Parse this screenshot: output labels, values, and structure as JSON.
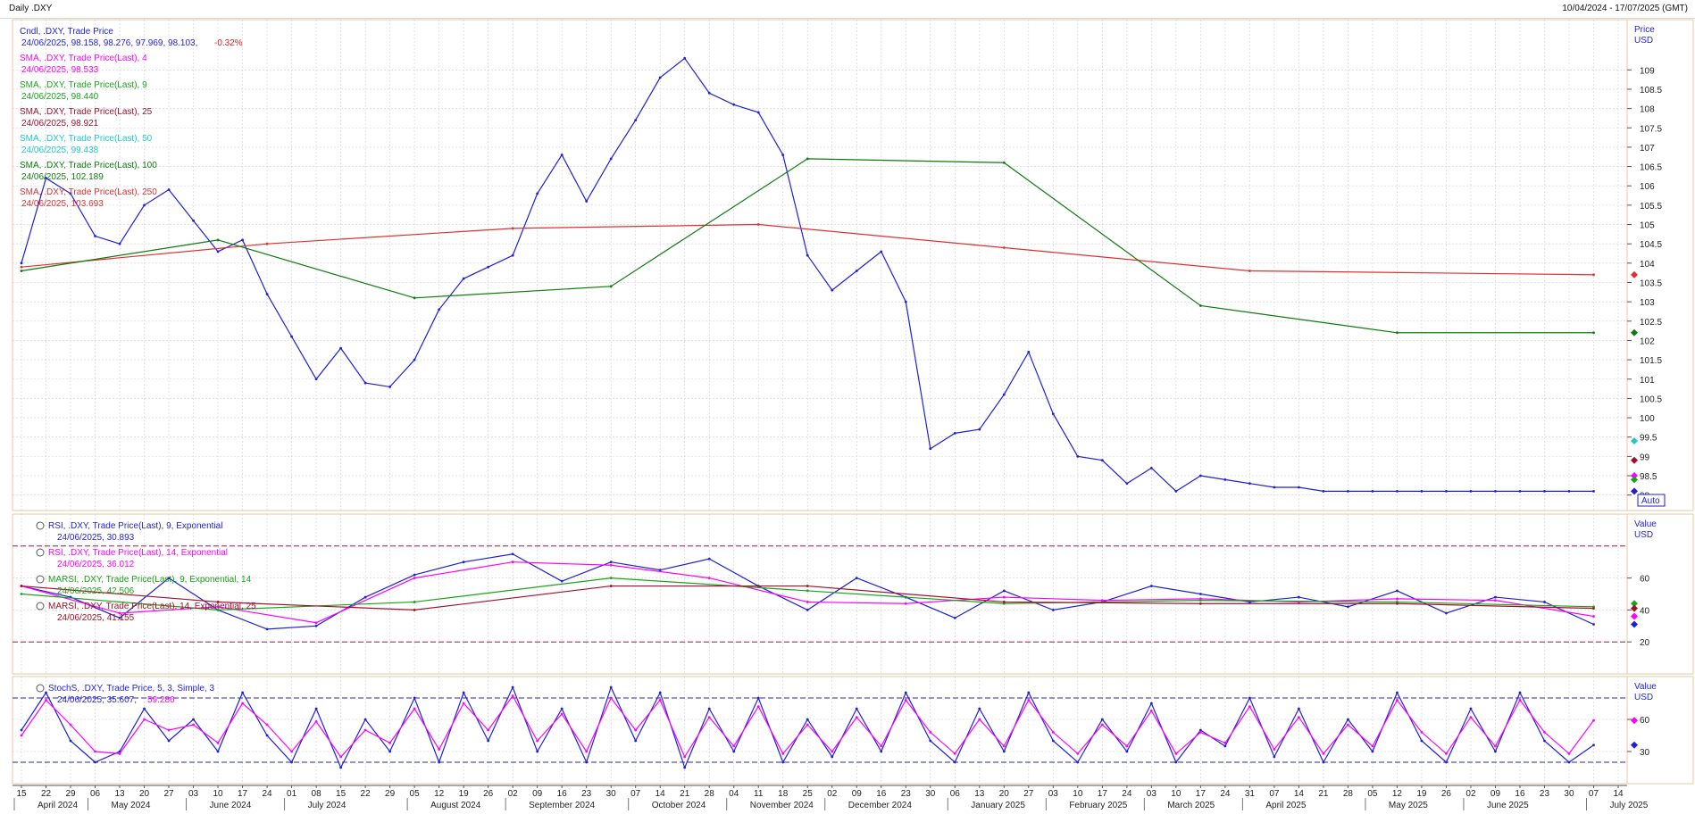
{
  "header": {
    "title": "Daily .DXY",
    "range": "10/04/2024 - 17/07/2025 (GMT)"
  },
  "chart_data": [
    {
      "type": "line",
      "panel": "price",
      "y_title": "Price",
      "y_unit": "USD",
      "auto_label": "Auto",
      "ylim": [
        97.6,
        110.3
      ],
      "yticks": [
        98,
        98.5,
        99,
        99.5,
        100,
        100.5,
        101,
        101.5,
        102,
        102.5,
        103,
        103.5,
        104,
        104.5,
        105,
        105.5,
        106,
        106.5,
        107,
        107.5,
        108,
        108.5,
        109
      ],
      "x_index_range": [
        0,
        66
      ],
      "legend": [
        {
          "name": "Cndl, .DXY, Trade Price",
          "value": "24/06/2025, 98.158, 98.276, 97.969, 98.103,",
          "change": "-0.32%",
          "color": "#1f1fd6",
          "change_color": "#e02020"
        },
        {
          "name": "SMA, .DXY, Trade Price(Last), 4",
          "value": "24/06/2025, 98.533",
          "color": "#ff00ff"
        },
        {
          "name": "SMA, .DXY, Trade Price(Last), 9",
          "value": "24/06/2025, 98.440",
          "color": "#1aa31a"
        },
        {
          "name": "SMA, .DXY, Trade Price(Last), 25",
          "value": "24/06/2025, 98.921",
          "color": "#a0102a"
        },
        {
          "name": "SMA, .DXY, Trade Price(Last), 50",
          "value": "24/06/2025, 99.438",
          "color": "#22c8c8"
        },
        {
          "name": "SMA, .DXY, Trade Price(Last), 100",
          "value": "24/06/2025, 102.189",
          "color": "#0f7a0f"
        },
        {
          "name": "SMA, .DXY, Trade Price(Last), 250",
          "value": "24/06/2025, 103.693",
          "color": "#e03030"
        }
      ],
      "series": [
        {
          "name": "Cndl, .DXY, Trade Price",
          "color": "#1f1fd6",
          "x": [
            0,
            1,
            2,
            3,
            4,
            5,
            6,
            7,
            8,
            9,
            10,
            11,
            12,
            13,
            14,
            15,
            16,
            17,
            18,
            19,
            20,
            21,
            22,
            23,
            24,
            25,
            26,
            27,
            28,
            29,
            30,
            31,
            32,
            33,
            34,
            35,
            36,
            37,
            38,
            39,
            40,
            41,
            42,
            43,
            44,
            45,
            46,
            47,
            48,
            49,
            50,
            51,
            52,
            53,
            54,
            55,
            56,
            57,
            58,
            59,
            60,
            61,
            62,
            63,
            64
          ],
          "y": [
            104.0,
            106.2,
            105.8,
            104.7,
            104.5,
            105.5,
            105.9,
            105.1,
            104.3,
            104.6,
            103.2,
            102.1,
            101.0,
            101.8,
            100.9,
            100.8,
            101.5,
            102.8,
            103.6,
            103.9,
            104.2,
            105.8,
            106.8,
            105.6,
            106.7,
            107.7,
            108.8,
            109.3,
            108.4,
            108.1,
            107.9,
            106.8,
            104.2,
            103.3,
            103.8,
            104.3,
            103.0,
            99.2,
            99.6,
            99.7,
            100.6,
            101.7,
            100.1,
            99.0,
            98.9,
            98.3,
            98.7,
            98.1,
            98.5,
            98.4,
            98.3,
            98.2,
            98.2,
            98.1,
            98.1,
            98.1,
            98.1,
            98.1,
            98.1,
            98.1,
            98.1,
            98.1,
            98.1,
            98.1,
            98.1
          ]
        },
        {
          "name": "SMA, .DXY, Trade Price(Last), 250",
          "color": "#e03030",
          "x": [
            0,
            10,
            20,
            30,
            40,
            50,
            64
          ],
          "y": [
            103.9,
            104.5,
            104.9,
            105.0,
            104.4,
            103.8,
            103.7
          ]
        },
        {
          "name": "SMA, .DXY, Trade Price(Last), 100",
          "color": "#0f7a0f",
          "x": [
            0,
            8,
            16,
            24,
            32,
            40,
            48,
            56,
            64
          ],
          "y": [
            103.8,
            104.6,
            103.1,
            103.4,
            106.7,
            106.6,
            102.9,
            102.2,
            102.2
          ]
        }
      ],
      "end_markers": [
        {
          "y": 103.7,
          "color": "#e03030"
        },
        {
          "y": 102.2,
          "color": "#0f7a0f"
        },
        {
          "y": 99.4,
          "color": "#22c8c8"
        },
        {
          "y": 98.9,
          "color": "#a0102a"
        },
        {
          "y": 98.5,
          "color": "#ff00ff"
        },
        {
          "y": 98.4,
          "color": "#1aa31a"
        },
        {
          "y": 98.1,
          "color": "#1f1fd6"
        }
      ]
    },
    {
      "type": "line",
      "panel": "rsi",
      "y_title": "Value",
      "y_unit": "USD",
      "ylim": [
        0,
        100
      ],
      "yticks": [
        20,
        40,
        60
      ],
      "hlines": [
        20,
        80
      ],
      "legend": [
        {
          "name": "RSI, .DXY, Trade Price(Last), 9, Exponential",
          "value": "24/06/2025, 30.893",
          "color": "#1f1fd6"
        },
        {
          "name": "RSI, .DXY, Trade Price(Last), 14, Exponential",
          "value": "24/06/2025, 36.012",
          "color": "#ff00ff"
        },
        {
          "name": "MARSI, .DXY, Trade Price(Last), 9, Exponential, 14",
          "value": "24/06/2025, 42.506",
          "color": "#1aa31a"
        },
        {
          "name": "MARSI, .DXY, Trade Price(Last), 14, Exponential, 25",
          "value": "24/06/2025, 41.155",
          "color": "#a0102a"
        }
      ],
      "series": [
        {
          "name": "RSI, .DXY, Trade Price(Last), 9, Exponential",
          "color": "#1f1fd6",
          "x": [
            0,
            2,
            4,
            6,
            8,
            10,
            12,
            14,
            16,
            18,
            20,
            22,
            24,
            26,
            28,
            30,
            32,
            34,
            36,
            38,
            40,
            42,
            44,
            46,
            48,
            50,
            52,
            54,
            56,
            58,
            60,
            62,
            64
          ],
          "y": [
            55,
            48,
            35,
            60,
            40,
            28,
            30,
            48,
            62,
            70,
            75,
            58,
            70,
            65,
            72,
            55,
            40,
            60,
            48,
            35,
            52,
            40,
            45,
            55,
            50,
            45,
            48,
            42,
            52,
            38,
            48,
            45,
            31
          ]
        },
        {
          "name": "RSI, .DXY, Trade Price(Last), 14, Exponential",
          "color": "#ff00ff",
          "x": [
            0,
            4,
            8,
            12,
            16,
            20,
            24,
            28,
            32,
            36,
            40,
            44,
            48,
            52,
            56,
            60,
            64
          ],
          "y": [
            55,
            38,
            42,
            32,
            60,
            70,
            68,
            60,
            45,
            44,
            48,
            46,
            47,
            45,
            47,
            46,
            36
          ]
        },
        {
          "name": "MARSI, .DXY, Trade Price(Last), 9, Exponential, 14",
          "color": "#1aa31a",
          "x": [
            0,
            8,
            16,
            24,
            32,
            40,
            48,
            56,
            64
          ],
          "y": [
            50,
            40,
            45,
            60,
            52,
            44,
            46,
            45,
            42
          ]
        },
        {
          "name": "MARSI, .DXY, Trade Price(Last), 14, Exponential, 25",
          "color": "#a0102a",
          "x": [
            0,
            8,
            16,
            24,
            32,
            40,
            48,
            56,
            64
          ],
          "y": [
            55,
            45,
            40,
            55,
            55,
            45,
            44,
            44,
            41
          ]
        }
      ],
      "end_markers": [
        {
          "y": 44,
          "color": "#1aa31a"
        },
        {
          "y": 41,
          "color": "#a0102a"
        },
        {
          "y": 36,
          "color": "#ff00ff"
        },
        {
          "y": 31,
          "color": "#1f1fd6"
        }
      ]
    },
    {
      "type": "line",
      "panel": "stoch",
      "y_title": "Value",
      "y_unit": "USD",
      "ylim": [
        0,
        100
      ],
      "yticks": [
        30,
        60
      ],
      "hlines": [
        20,
        80
      ],
      "legend": [
        {
          "name": "StochS, .DXY, Trade Price, 5, 3, Simple, 3",
          "value": "24/06/2025, 35.607,",
          "value2": "59.286",
          "color": "#1f1fd6",
          "color2": "#ff00ff"
        }
      ],
      "series": [
        {
          "name": "StochS %K",
          "color": "#1f1fd6",
          "x": [
            0,
            1,
            2,
            3,
            4,
            5,
            6,
            7,
            8,
            9,
            10,
            11,
            12,
            13,
            14,
            15,
            16,
            17,
            18,
            19,
            20,
            21,
            22,
            23,
            24,
            25,
            26,
            27,
            28,
            29,
            30,
            31,
            32,
            33,
            34,
            35,
            36,
            37,
            38,
            39,
            40,
            41,
            42,
            43,
            44,
            45,
            46,
            47,
            48,
            49,
            50,
            51,
            52,
            53,
            54,
            55,
            56,
            57,
            58,
            59,
            60,
            61,
            62,
            63,
            64
          ],
          "y": [
            50,
            85,
            40,
            20,
            30,
            70,
            40,
            60,
            30,
            85,
            45,
            20,
            70,
            15,
            60,
            30,
            80,
            20,
            85,
            40,
            90,
            30,
            70,
            20,
            90,
            40,
            85,
            15,
            70,
            30,
            80,
            20,
            60,
            25,
            70,
            30,
            85,
            40,
            20,
            70,
            30,
            85,
            40,
            20,
            60,
            30,
            75,
            20,
            50,
            35,
            80,
            25,
            70,
            20,
            60,
            30,
            85,
            40,
            20,
            70,
            30,
            85,
            40,
            20,
            36
          ]
        },
        {
          "name": "StochS %D",
          "color": "#ff00ff",
          "x": [
            0,
            1,
            2,
            3,
            4,
            5,
            6,
            7,
            8,
            9,
            10,
            11,
            12,
            13,
            14,
            15,
            16,
            17,
            18,
            19,
            20,
            21,
            22,
            23,
            24,
            25,
            26,
            27,
            28,
            29,
            30,
            31,
            32,
            33,
            34,
            35,
            36,
            37,
            38,
            39,
            40,
            41,
            42,
            43,
            44,
            45,
            46,
            47,
            48,
            49,
            50,
            51,
            52,
            53,
            54,
            55,
            56,
            57,
            58,
            59,
            60,
            61,
            62,
            63,
            64
          ],
          "y": [
            45,
            78,
            55,
            30,
            28,
            60,
            50,
            55,
            38,
            75,
            55,
            30,
            58,
            25,
            50,
            38,
            70,
            32,
            75,
            50,
            82,
            40,
            65,
            30,
            80,
            50,
            78,
            25,
            62,
            35,
            72,
            28,
            55,
            30,
            62,
            35,
            78,
            48,
            28,
            60,
            35,
            78,
            48,
            28,
            55,
            35,
            68,
            28,
            48,
            38,
            72,
            32,
            62,
            28,
            55,
            35,
            78,
            48,
            28,
            62,
            35,
            78,
            48,
            28,
            59
          ]
        }
      ],
      "end_markers": [
        {
          "y": 59,
          "color": "#ff00ff"
        },
        {
          "y": 36,
          "color": "#1f1fd6"
        }
      ]
    }
  ],
  "x_axis": {
    "day_labels": [
      "15",
      "22",
      "29",
      "06",
      "13",
      "20",
      "27",
      "03",
      "10",
      "17",
      "24",
      "01",
      "08",
      "15",
      "22",
      "29",
      "05",
      "12",
      "19",
      "26",
      "02",
      "09",
      "16",
      "23",
      "30",
      "07",
      "14",
      "21",
      "28",
      "04",
      "11",
      "18",
      "25",
      "02",
      "09",
      "16",
      "23",
      "30",
      "06",
      "13",
      "20",
      "27",
      "03",
      "10",
      "17",
      "24",
      "03",
      "10",
      "17",
      "24",
      "31",
      "07",
      "14",
      "21",
      "28",
      "05",
      "12",
      "19",
      "26",
      "02",
      "09",
      "16",
      "23",
      "30",
      "07",
      "14"
    ],
    "month_labels": [
      "April 2024",
      "May 2024",
      "June 2024",
      "July 2024",
      "August 2024",
      "September 2024",
      "October 2024",
      "November 2024",
      "December 2024",
      "January 2025",
      "February 2025",
      "March 2025",
      "April 2025",
      "May 2025",
      "June 2025",
      "July 2025"
    ],
    "month_start_index": [
      0,
      3,
      7,
      11,
      16,
      20,
      25,
      29,
      33,
      38,
      42,
      46,
      50,
      55,
      59,
      64
    ]
  }
}
